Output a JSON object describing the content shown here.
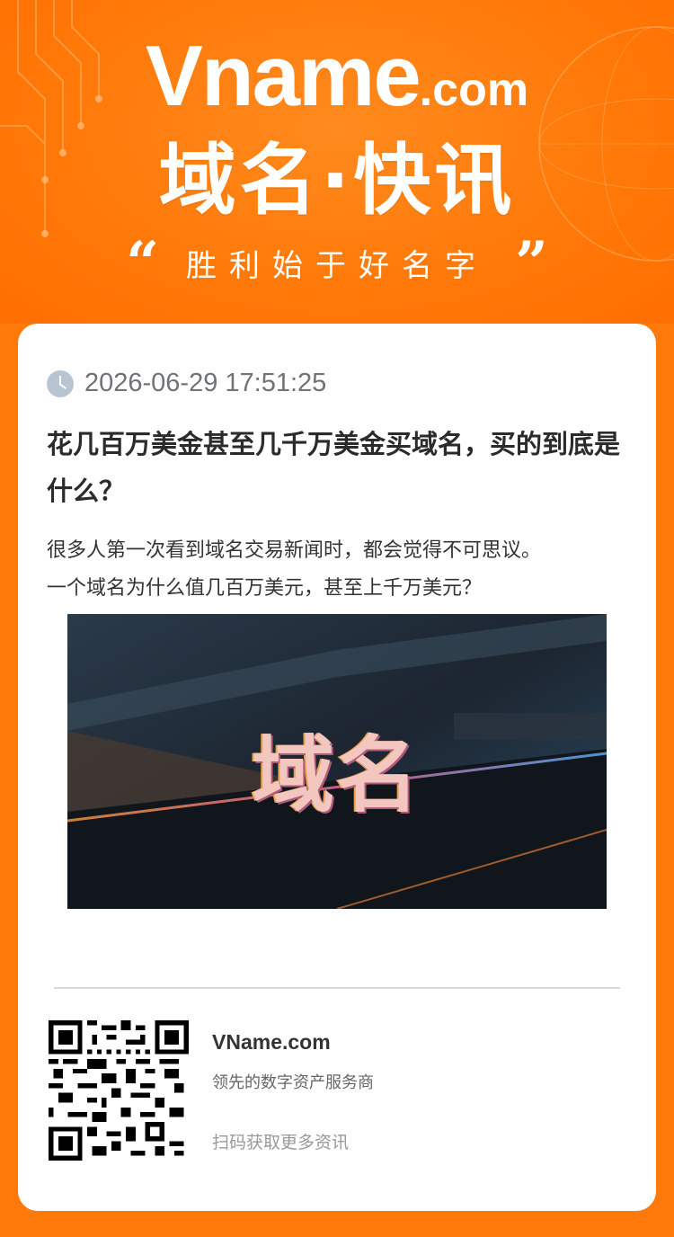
{
  "header": {
    "brand_main": "Vname",
    "brand_suffix": ".com",
    "headline": "域名·快讯",
    "slogan": "胜利始于好名字",
    "quote_open": "“",
    "quote_close": "”"
  },
  "article": {
    "timestamp": "2026-06-29 17:51:25",
    "title": "花几百万美金甚至几千万美金买域名，买的到底是什么？",
    "summary_line1": "很多人第一次看到域名交易新闻时，都会觉得不可思议。",
    "summary_line2": "一个域名为什么值几百万美元，甚至上千万美元？",
    "image_text": "域名"
  },
  "footer": {
    "company": "VName.com",
    "tagline": "领先的数字资产服务商",
    "scan_prompt": "扫码获取更多资讯"
  },
  "colors": {
    "brand_orange": "#ff7a0a",
    "card_bg": "#ffffff",
    "title_text": "#2b2b2b"
  },
  "icons": [
    "clock-icon",
    "qr-code"
  ]
}
